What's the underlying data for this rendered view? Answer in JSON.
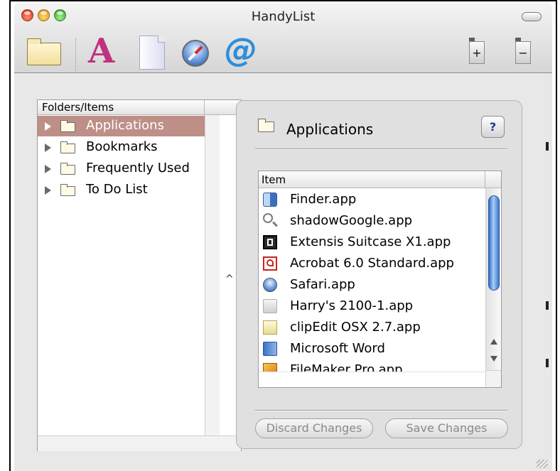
{
  "window": {
    "title": "HandyList"
  },
  "toolbar": {
    "add_label": "+",
    "remove_label": "−",
    "font_glyph": "A",
    "email_glyph": "@"
  },
  "outline": {
    "header": "Folders/Items",
    "items": [
      {
        "label": "Applications",
        "selected": true
      },
      {
        "label": "Bookmarks",
        "selected": false
      },
      {
        "label": "Frequently Used",
        "selected": false
      },
      {
        "label": "To Do List",
        "selected": false
      }
    ]
  },
  "detail": {
    "title": "Applications",
    "help_label": "?",
    "table_header": "Item",
    "items": [
      {
        "label": "Finder.app",
        "icon": "finder-icon"
      },
      {
        "label": "shadowGoogle.app",
        "icon": "magnifier-icon"
      },
      {
        "label": "Extensis Suitcase X1.app",
        "icon": "suitcase-icon"
      },
      {
        "label": "Acrobat 6.0 Standard.app",
        "icon": "acrobat-icon"
      },
      {
        "label": "Safari.app",
        "icon": "safari-icon"
      },
      {
        "label": "Harry's 2100-1.app",
        "icon": "harrys-icon"
      },
      {
        "label": "clipEdit OSX 2.7.app",
        "icon": "clipedit-icon"
      },
      {
        "label": "Microsoft Word",
        "icon": "word-icon"
      },
      {
        "label": "FileMaker Pro.app",
        "icon": "filemaker-icon"
      }
    ],
    "discard_label": "Discard Changes",
    "save_label": "Save Changes"
  },
  "colors": {
    "selection": "#bd8f87",
    "scroll_thumb": "#3b78cf",
    "font_icon": "#c2317d",
    "email_icon": "#2f8ed8"
  }
}
